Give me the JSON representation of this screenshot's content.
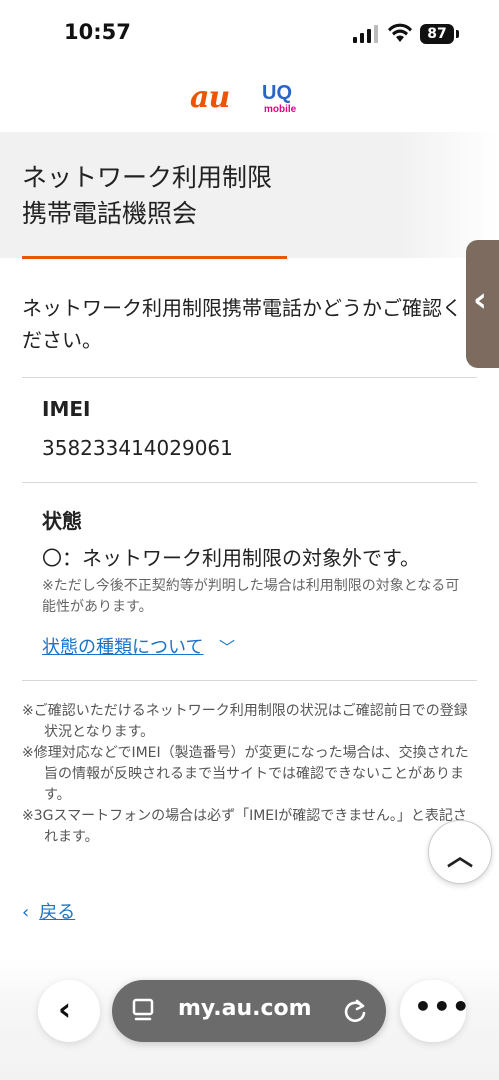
{
  "status_bar": {
    "time": "10:57",
    "battery": "87"
  },
  "brand": {
    "au_logo": "au",
    "uq_logo": "UQ",
    "uq_sub": "mobile"
  },
  "header": {
    "title_line1": "ネットワーク利用制限",
    "title_line2": "携帯電話機照会"
  },
  "main": {
    "intro": "ネットワーク利用制限携帯電話かどうかご確認ください。",
    "imei_label": "IMEI",
    "imei_value": "358233414029061",
    "status_label": "状態",
    "status_value": "〇：ネットワーク利用制限の対象外です。",
    "status_note": "※ただし今後不正契約等が判明した場合は利用制限の対象となる可能性があります。",
    "status_types_link": "状態の種類について"
  },
  "footnotes": [
    "※ご確認いただけるネットワーク利用制限の状況はご確認前日での登録状況となります。",
    "※修理対応などでIMEI（製造番号）が変更になった場合は、交換された旨の情報が反映されるまで当サイトでは確認できないことがあります。",
    "※3Gスマートフォンの場合は必ず「IMEIが確認できません。」と表記されます。"
  ],
  "back_link": "戻る",
  "browser": {
    "url": "my.au.com"
  },
  "colors": {
    "accent": "#eb5505",
    "link": "#1a73c8"
  }
}
